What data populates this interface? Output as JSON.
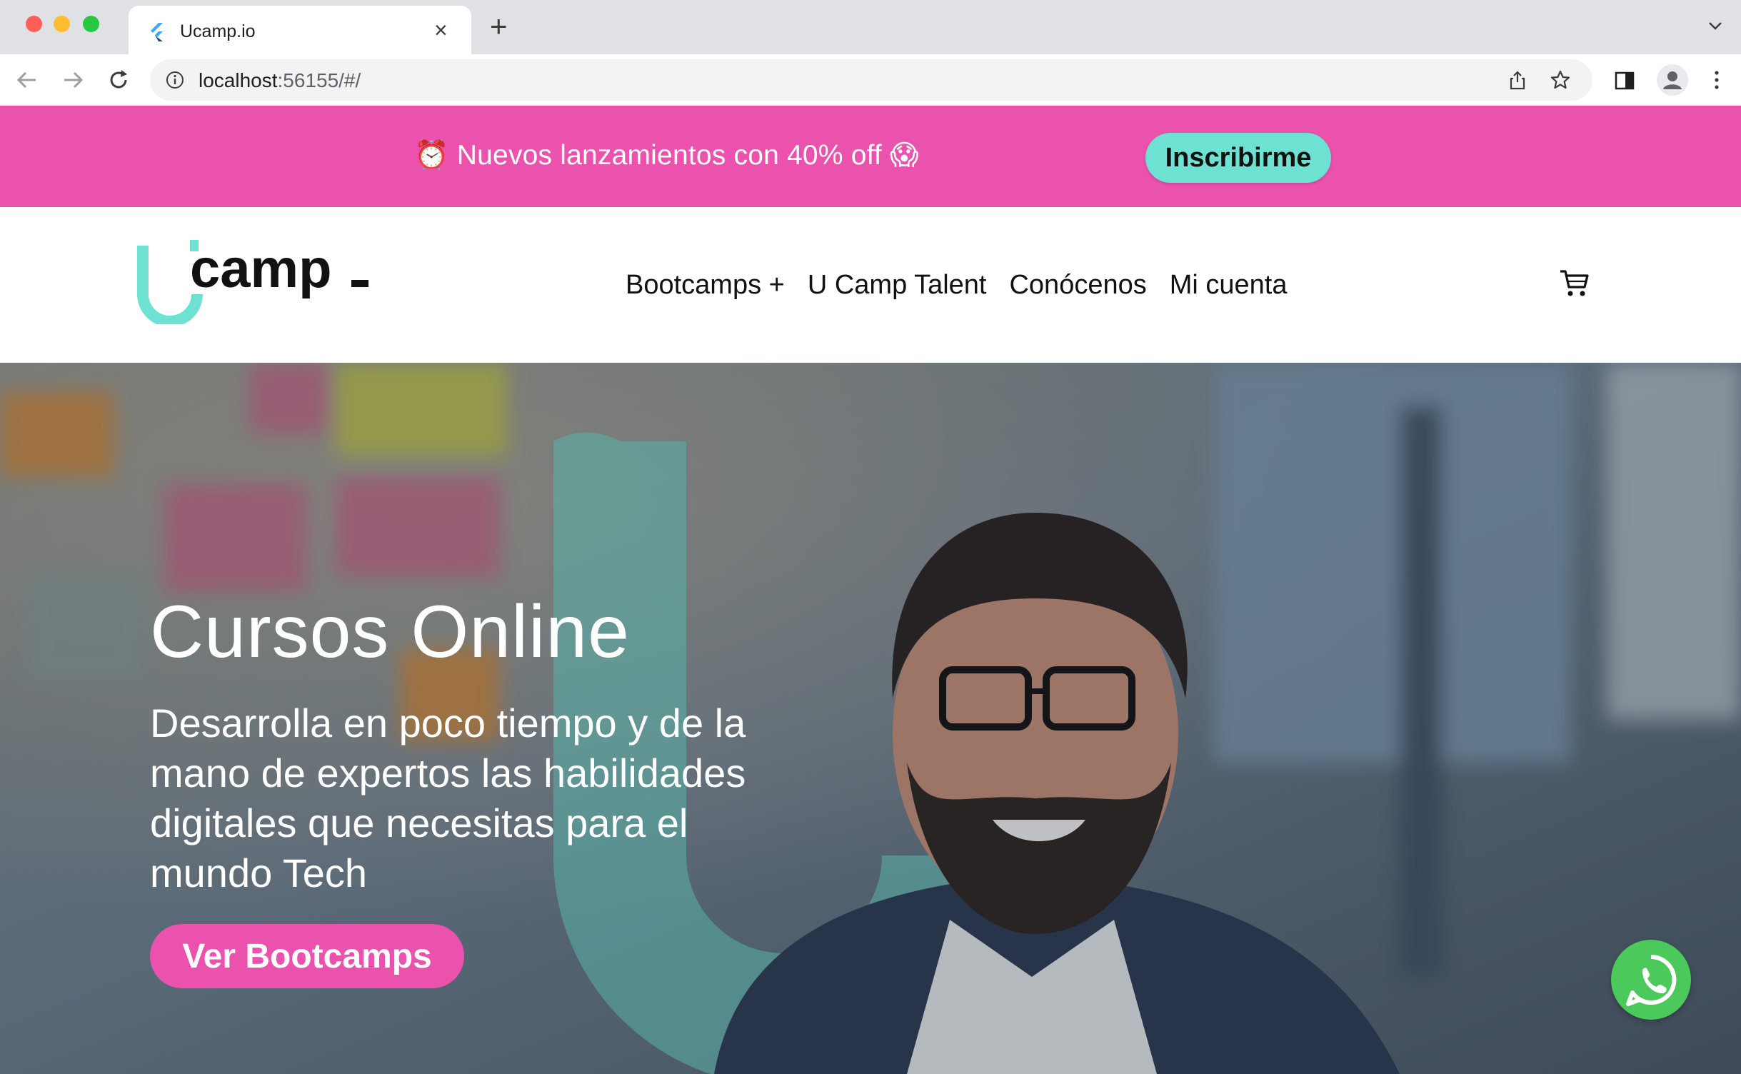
{
  "browser": {
    "tab_title": "Ucamp.io",
    "url_host": "localhost",
    "url_rest": ":56155/#/",
    "icons": {
      "favicon": "flutter-icon",
      "close": "close-icon",
      "new_tab": "plus-icon",
      "tab_menu": "chevron-down-icon",
      "back": "arrow-left-icon",
      "forward": "arrow-right-icon",
      "reload": "reload-icon",
      "info": "info-icon",
      "share": "share-icon",
      "bookmark": "star-icon",
      "side_panel": "side-panel-icon",
      "profile": "profile-icon",
      "menu": "kebab-menu-icon"
    }
  },
  "promo": {
    "text": "⏰ Nuevos lanzamientos con 40% off 😱",
    "button_label": "Inscribirme",
    "background": "#ea52ae",
    "button_color": "#6ee2d2"
  },
  "header": {
    "logo_text": "camp",
    "nav": [
      {
        "label": "Bootcamps +"
      },
      {
        "label": "U Camp Talent"
      },
      {
        "label": "Conócenos"
      },
      {
        "label": "Mi cuenta"
      }
    ],
    "cart_icon": "cart-icon"
  },
  "hero": {
    "title": "Cursos Online",
    "subtitle": "Desarrolla en poco tiempo y de la mano de expertos las habilidades digitales que necesitas para el mundo Tech",
    "cta_label": "Ver Bootcamps",
    "accent": "#6ee2d2",
    "cta_color": "#ea52ae",
    "chat_icon": "whatsapp-icon"
  }
}
